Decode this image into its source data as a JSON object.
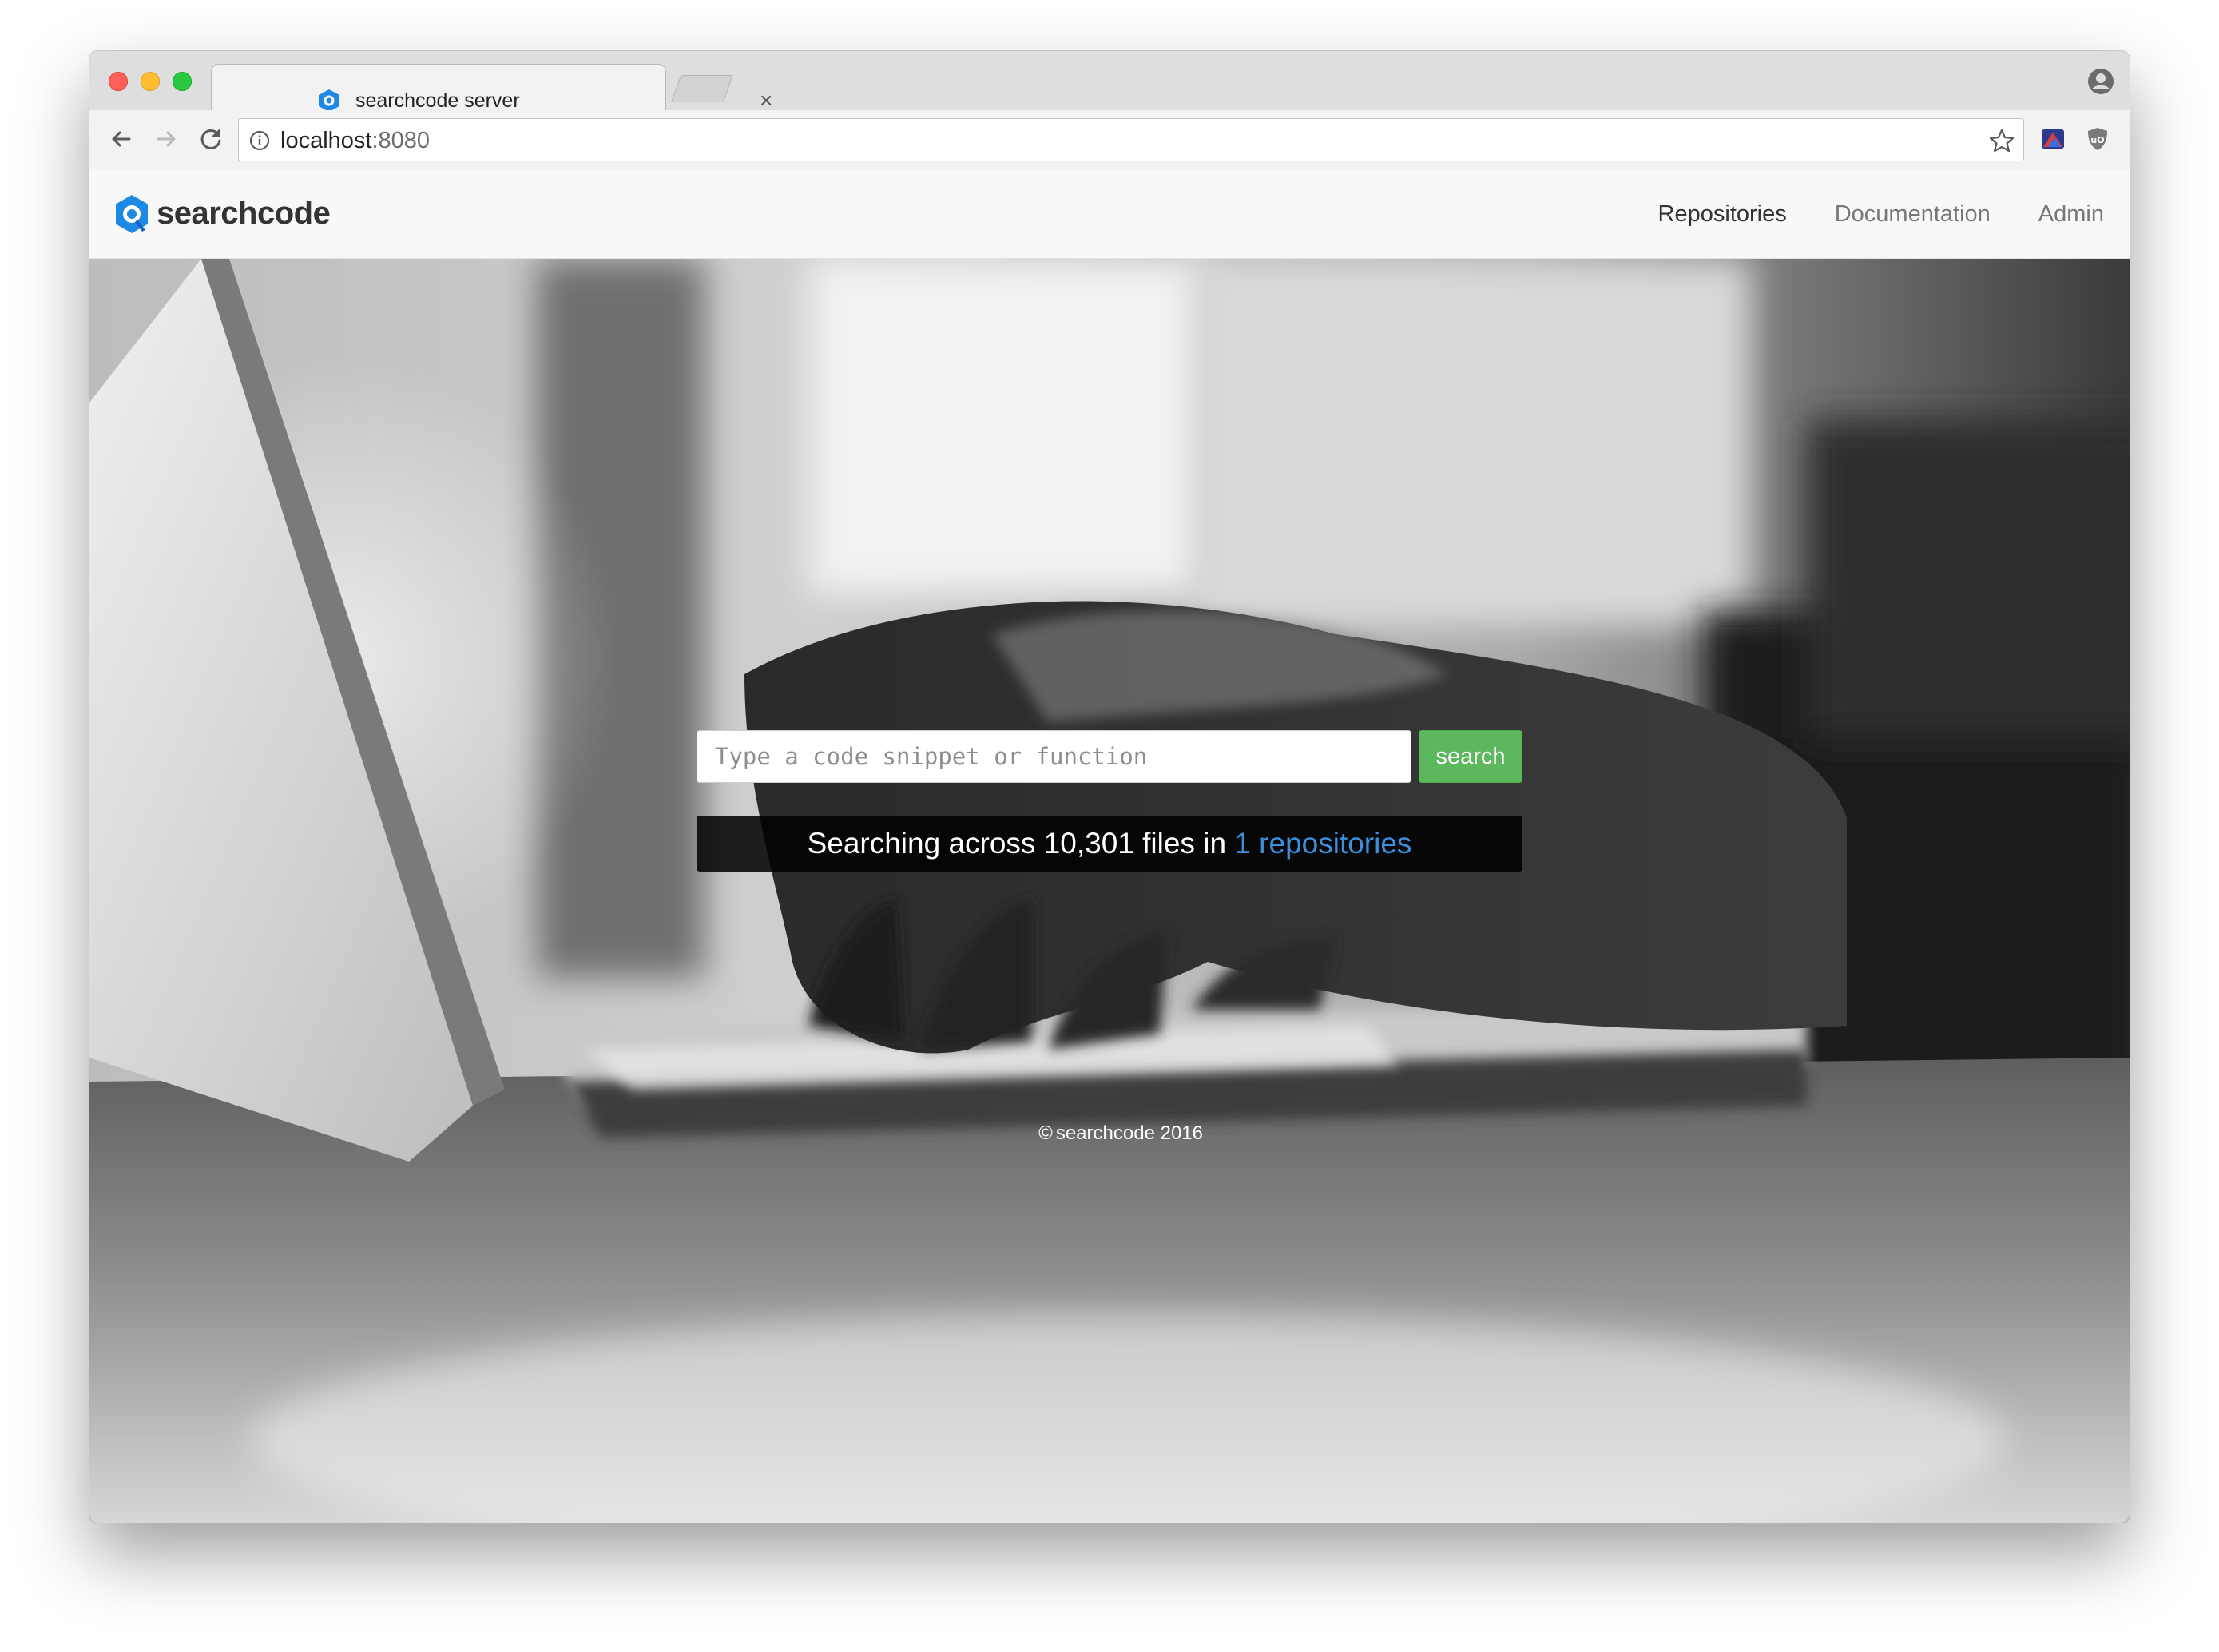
{
  "browser": {
    "tab_title": "searchcode server",
    "tab_close": "×",
    "url_host": "localhost",
    "url_port": ":8080",
    "icons": [
      "back-arrow-icon",
      "forward-arrow-icon",
      "reload-icon",
      "info-icon",
      "star-icon",
      "profile-icon",
      "menu-dots-icon"
    ]
  },
  "site": {
    "logo_text": "searchcode",
    "nav": [
      {
        "label": "Repositories"
      },
      {
        "label": "Documentation"
      },
      {
        "label": "Admin"
      }
    ]
  },
  "search": {
    "placeholder": "Type a code snippet or function",
    "value": "",
    "button_label": "search"
  },
  "stats": {
    "prefix": "Searching across 10,301 files in ",
    "link_label": "1 repositories"
  },
  "footer": {
    "copyright": "©",
    "text": "searchcode 2016"
  },
  "colors": {
    "accent_green": "#5cb85c",
    "link_blue": "#3c8fdc",
    "logo_blue": "#1e88e5"
  }
}
